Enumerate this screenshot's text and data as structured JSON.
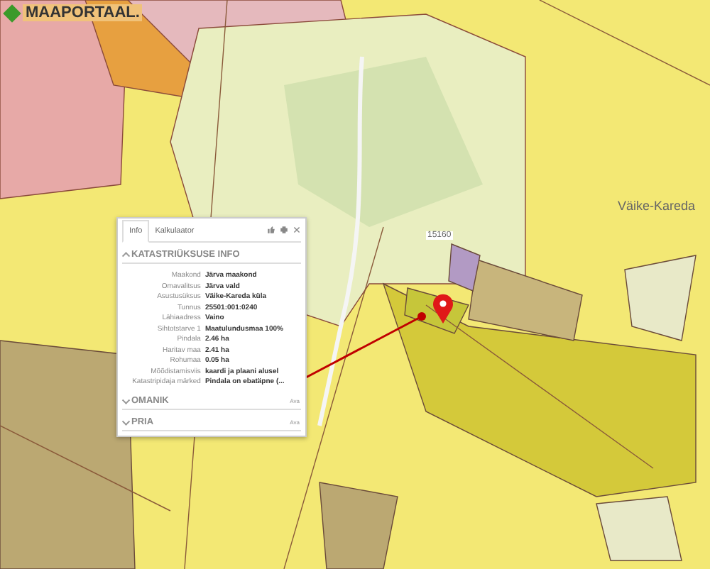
{
  "logo": {
    "text": "MAAPORTAAL."
  },
  "map_labels": {
    "place": "Väike-Kareda",
    "road_number": "15160"
  },
  "popup": {
    "tabs": [
      {
        "label": "Info",
        "selected": true
      },
      {
        "label": "Kalkulaator",
        "selected": false
      }
    ],
    "sections": [
      {
        "title": "KATASTRIÜKSUSE INFO",
        "expanded": true,
        "rows": [
          {
            "label": "Maakond",
            "value": "Järva maakond"
          },
          {
            "label": "Omavalitsus",
            "value": "Järva vald"
          },
          {
            "label": "Asustusüksus",
            "value": "Väike-Kareda küla"
          },
          {
            "label": "Tunnus",
            "value": "25501:001:0240"
          },
          {
            "label": "Lähiaadress",
            "value": "Vaino"
          },
          {
            "label": "Sihtotstarve 1",
            "value": "Maatulundusmaa 100%"
          },
          {
            "label": "Pindala",
            "value": "2.46 ha"
          },
          {
            "label": "Haritav maa",
            "value": "2.41 ha"
          },
          {
            "label": "Rohumaa",
            "value": "0.05 ha"
          },
          {
            "label": "Mõõdistamisviis",
            "value": "kaardi ja plaani alusel"
          },
          {
            "label": "Katastripidaja märked",
            "value": "Pindala on ebatäpne (..."
          }
        ]
      },
      {
        "title": "OMANIK",
        "expanded": false,
        "action": "Ava"
      },
      {
        "title": "PRIA",
        "expanded": false,
        "action": "Ava"
      }
    ]
  }
}
